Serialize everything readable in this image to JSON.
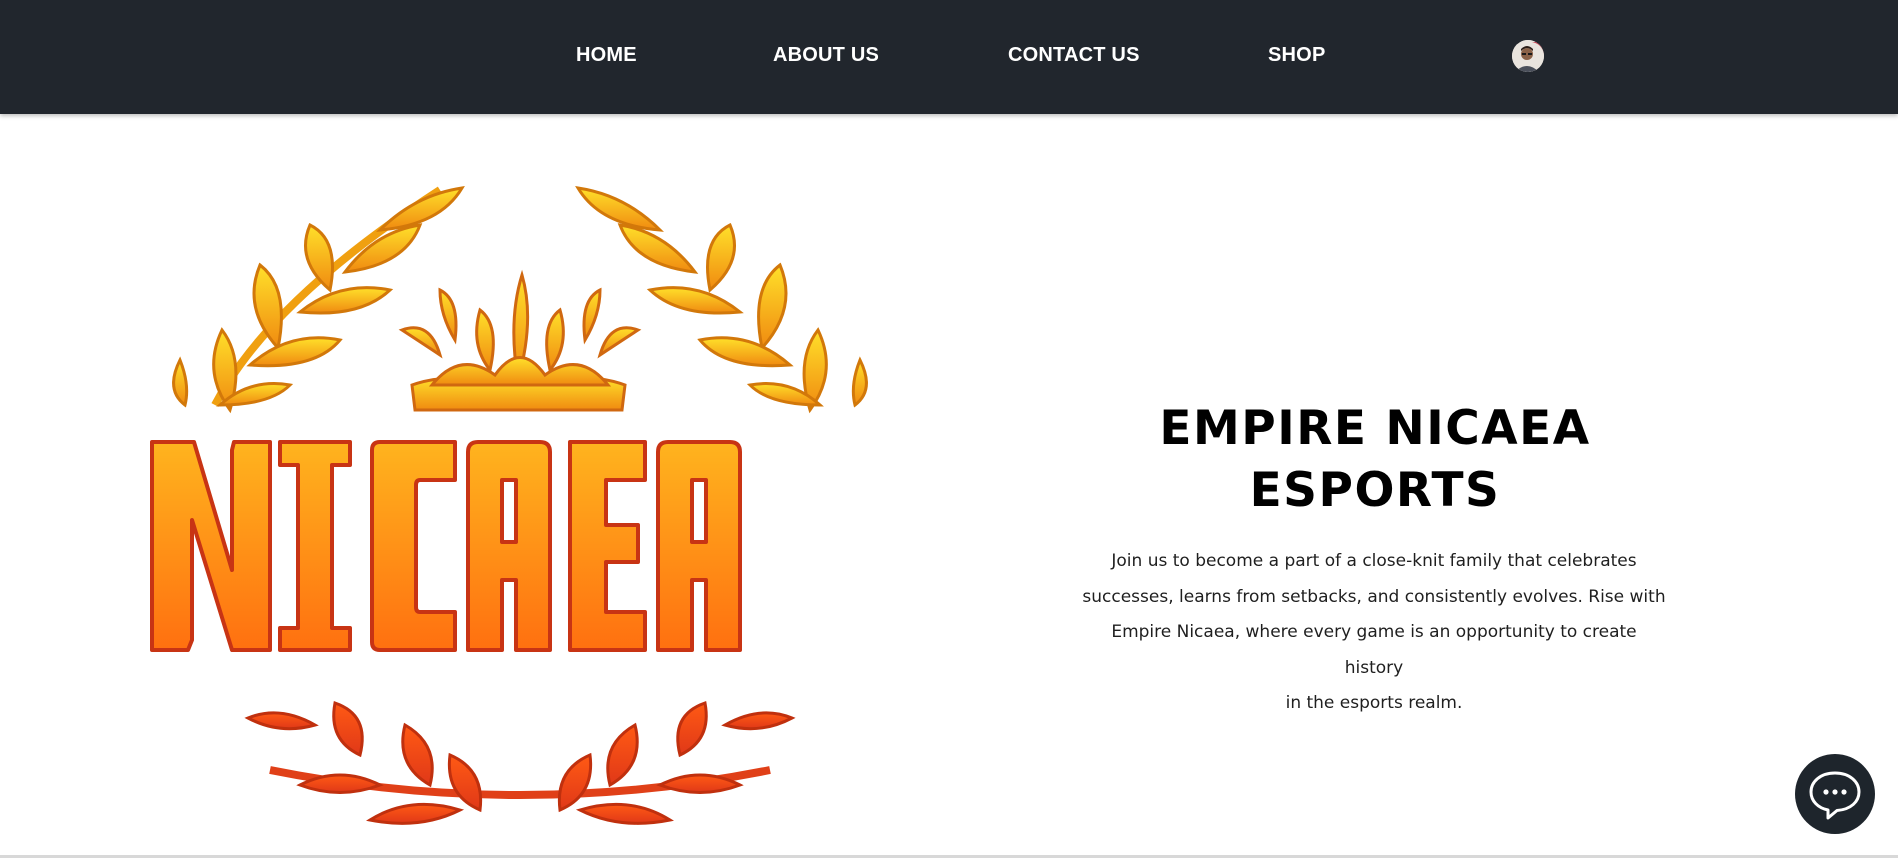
{
  "nav": {
    "items": [
      {
        "label": "HOME"
      },
      {
        "label": "ABOUT US"
      },
      {
        "label": "CONTACT US"
      },
      {
        "label": "SHOP"
      }
    ],
    "avatar_icon": "user-avatar-icon",
    "background": "#21262d"
  },
  "hero": {
    "logo": {
      "wordmark": "NICAEA",
      "emblem_icons": [
        "laurel-wreath-icon",
        "crown-icon"
      ],
      "colors": {
        "gold": "#ffd21a",
        "orange": "#ff8a14",
        "red": "#e0401a"
      }
    },
    "title_line1": "EMPIRE NICAEA",
    "title_line2": "ESPORTS",
    "body_lines": [
      "Join us to become a part of a close-knit family that celebrates",
      "successes, learns from setbacks, and consistently evolves. Rise with",
      "Empire Nicaea, where every game is an opportunity to create history",
      "in the esports realm."
    ]
  },
  "chat": {
    "icon": "chat-bubble-icon",
    "background": "#1e252c"
  }
}
